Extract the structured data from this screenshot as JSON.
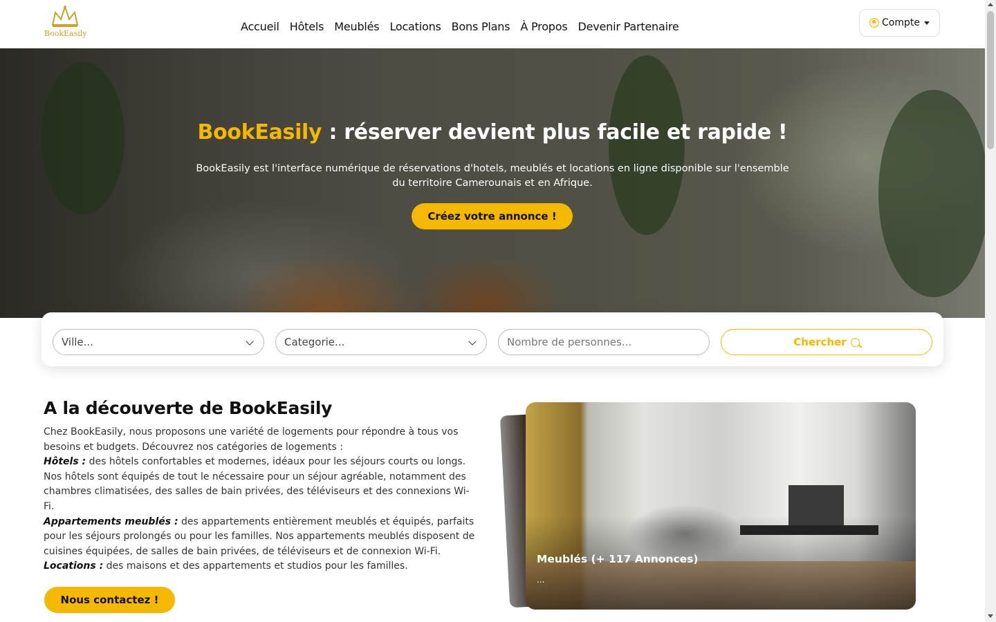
{
  "header": {
    "logo_text": "BookEasily",
    "nav": [
      "Accueil",
      "Hôtels",
      "Meublés",
      "Locations",
      "Bons Plans",
      "À Propos",
      "Devenir Partenaire"
    ],
    "account_label": "Compte"
  },
  "hero": {
    "title_brand": "BookEasily",
    "title_rest": " : réserver devient plus facile et rapide !",
    "subtitle": "BookEasily est l'interface numérique de réservations d'hotels, meublés et locations en ligne disponible sur l'ensemble du territoire Camerounais et en Afrique.",
    "cta": "Créez votre annonce !"
  },
  "search": {
    "city_value": "Ville...",
    "category_value": "Categorie...",
    "persons_placeholder": "Nombre de personnes...",
    "button_label": "Chercher"
  },
  "about": {
    "title": "A la découverte de BookEasily",
    "intro": "Chez BookEasily, nous proposons une variété de logements pour répondre à tous vos besoins et budgets. Découvrez nos catégories de logements :",
    "hotels_label": "Hôtels :",
    "hotels_text": " des hôtels confortables et modernes, idéaux pour les séjours courts ou longs. Nos hôtels sont équipés de tout le nécessaire pour un séjour agréable, notamment des chambres climatisées, des salles de bain privées, des téléviseurs et des connexions Wi-Fi.",
    "furnished_label": "Appartements meublés :",
    "furnished_text": " des appartements entièrement meublés et équipés, parfaits pour les séjours prolongés ou pour les familles. Nos appartements meublés disposent de cuisines équipées, de salles de bain privées, de téléviseurs et de connexion Wi-Fi.",
    "rentals_label": "Locations :",
    "rentals_text": " des maisons et des appartements et studios pour les familles.",
    "contact_button": "Nous contactez !"
  },
  "carousel": {
    "card_title": "Meublés (+ 117 Annonces)",
    "card_sub": "..."
  },
  "colors": {
    "accent": "#f5b800",
    "text": "#111111"
  }
}
